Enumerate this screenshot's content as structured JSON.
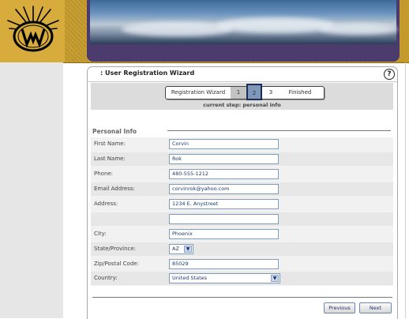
{
  "header": {
    "logo_icon": "w-starburst-logo",
    "colors": {
      "gold": "#c49a2c",
      "purple": "#4c3b6d"
    }
  },
  "wizard": {
    "title": ": User Registration Wizard",
    "help_label": "?",
    "steps": {
      "label": "Registration Wizard",
      "step1": "1",
      "step2": "2",
      "step3": "3",
      "finished": "Finished"
    },
    "current_step_text": "current step: personal info",
    "section_title": "Personal Info",
    "fields": {
      "first_name": {
        "label": "First Name:",
        "value": "Corvin"
      },
      "last_name": {
        "label": "Last Name:",
        "value": "Rok"
      },
      "phone": {
        "label": "Phone:",
        "value": "480-555-1212"
      },
      "email": {
        "label": "Email Address:",
        "value": "corvinrok@yahoo.com"
      },
      "address": {
        "label": "Address:",
        "value": "1234 E. Anystreet"
      },
      "address2": {
        "label": "",
        "value": ""
      },
      "city": {
        "label": "City:",
        "value": "Phoenix"
      },
      "state": {
        "label": "State/Province:",
        "value": "AZ"
      },
      "zip": {
        "label": "Zip/Postal Code:",
        "value": "85029"
      },
      "country": {
        "label": "Country:",
        "value": "United States"
      }
    },
    "buttons": {
      "previous": "Previous",
      "next": "Next"
    }
  }
}
